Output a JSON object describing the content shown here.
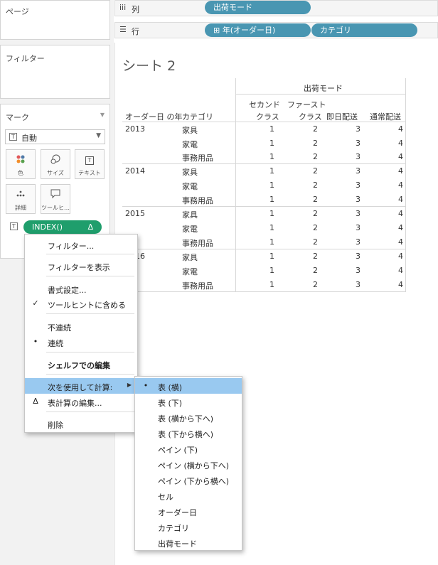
{
  "left": {
    "pages_title": "ページ",
    "filters_title": "フィルター",
    "marks": {
      "title": "マーク",
      "type_selected": "自動",
      "buttons": [
        {
          "label": "色",
          "icon": "color-dots-icon"
        },
        {
          "label": "サイズ",
          "icon": "size-icon"
        },
        {
          "label": "テキスト",
          "icon": "text-icon"
        },
        {
          "label": "詳細",
          "icon": "detail-dots-icon"
        },
        {
          "label": "ツールヒ…",
          "icon": "tooltip-icon"
        }
      ],
      "pill": {
        "label": "INDEX()",
        "badge": "Δ"
      }
    }
  },
  "shelves": {
    "columns": {
      "label": "列",
      "pills": [
        "出荷モード"
      ]
    },
    "rows": {
      "label": "行",
      "pills": [
        "⊞ 年(オーダー日)",
        "カテゴリ"
      ]
    }
  },
  "sheet": {
    "title": "シート 2",
    "header_group": "出荷モード",
    "row_headers": [
      "オーダー日 の年",
      "カテゴリ"
    ],
    "col_headers": [
      {
        "line1": "セカンド",
        "line2": "クラス"
      },
      {
        "line1": "ファースト",
        "line2": "クラス"
      },
      {
        "line1": "",
        "line2": "即日配送"
      },
      {
        "line1": "",
        "line2": "通常配送"
      }
    ],
    "years": [
      {
        "year": "2013",
        "rows": [
          {
            "cat": "家具",
            "values": [
              1,
              2,
              3,
              4
            ]
          },
          {
            "cat": "家電",
            "values": [
              1,
              2,
              3,
              4
            ]
          },
          {
            "cat": "事務用品",
            "values": [
              1,
              2,
              3,
              4
            ]
          }
        ]
      },
      {
        "year": "2014",
        "rows": [
          {
            "cat": "家具",
            "values": [
              1,
              2,
              3,
              4
            ]
          },
          {
            "cat": "家電",
            "values": [
              1,
              2,
              3,
              4
            ]
          },
          {
            "cat": "事務用品",
            "values": [
              1,
              2,
              3,
              4
            ]
          }
        ]
      },
      {
        "year": "2015",
        "rows": [
          {
            "cat": "家具",
            "values": [
              1,
              2,
              3,
              4
            ]
          },
          {
            "cat": "家電",
            "values": [
              1,
              2,
              3,
              4
            ]
          },
          {
            "cat": "事務用品",
            "values": [
              1,
              2,
              3,
              4
            ]
          }
        ]
      },
      {
        "year": "16",
        "rows": [
          {
            "cat": "家具",
            "values": [
              1,
              2,
              3,
              4
            ]
          },
          {
            "cat": "家電",
            "values": [
              1,
              2,
              3,
              4
            ]
          },
          {
            "cat": "事務用品",
            "values": [
              1,
              2,
              3,
              4
            ]
          }
        ]
      }
    ]
  },
  "context_menu": {
    "items": [
      {
        "label": "フィルター...",
        "mark": ""
      },
      {
        "label": "フィルターを表示",
        "mark": ""
      },
      {
        "label": "書式設定...",
        "mark": ""
      },
      {
        "label": "ツールヒントに含める",
        "mark": "✓"
      },
      {
        "label": "不連続",
        "mark": ""
      },
      {
        "label": "連続",
        "mark": "•"
      },
      {
        "label": "シェルフでの編集",
        "mark": ""
      },
      {
        "label": "次を使用して計算:",
        "mark": "",
        "arrow": "▶"
      },
      {
        "label": "表計算の編集...",
        "mark": "Δ"
      },
      {
        "label": "削除",
        "mark": ""
      }
    ]
  },
  "submenu": {
    "items": [
      {
        "label": "表 (横)",
        "mark": "•"
      },
      {
        "label": "表 (下)",
        "mark": ""
      },
      {
        "label": "表 (横から下へ)",
        "mark": ""
      },
      {
        "label": "表 (下から横へ)",
        "mark": ""
      },
      {
        "label": "ペイン (下)",
        "mark": ""
      },
      {
        "label": "ペイン (横から下へ)",
        "mark": ""
      },
      {
        "label": "ペイン (下から横へ)",
        "mark": ""
      },
      {
        "label": "セル",
        "mark": ""
      },
      {
        "label": "オーダー日",
        "mark": ""
      },
      {
        "label": "カテゴリ",
        "mark": ""
      },
      {
        "label": "出荷モード",
        "mark": ""
      }
    ]
  }
}
